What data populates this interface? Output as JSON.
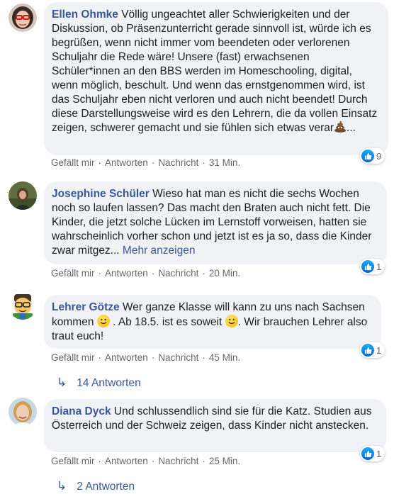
{
  "comments": [
    {
      "author": "Ellen Ohmke",
      "text": "Völlig ungeachtet aller Schwierigkeiten und der Diskussion, ob Präsenzunterricht gerade sinnvoll ist, würde ich es begrüßen, wenn nicht immer vom beendeten oder verlorenen Schuljahr die Rede wäre! Unsere (fast) erwachsenen Schüler*innen an den BBS werden im Homeschooling, digital, wenn möglich, beschult. Und wenn das ernstgenommen wird, ist das Schuljahr eben nicht verloren und auch nicht beendet! Durch diese Darstellungsweise wird es den Lehrern, die da vollen Einsatz zeigen, schwerer gemacht und sie fühlen sich etwas verar",
      "text_end": "...",
      "time": "31 Min.",
      "reactions": "9",
      "avatar_icon": "woman-red-glasses-avatar"
    },
    {
      "author": "Josephine Schüler",
      "text": "Wieso hat man es nicht die sechs Wochen noch so laufen lassen? Das macht den Braten auch nicht fett. Die Kinder, die jetzt solche Lücken im Lernstoff vorweisen, hatten sie wahrscheinlich vorher schon und jetzt ist es ja so, dass die Kinder zwar mitgez...",
      "more": "Mehr anzeigen",
      "time": "20 Min.",
      "reactions": "1",
      "avatar_icon": "woman-outdoor-avatar"
    },
    {
      "author": "Lehrer Götze",
      "text_a": "Wer ganze Klasse will kann zu uns nach Sachsen kommen",
      "text_b": ". Ab 18.5. ist es soweit",
      "text_c": ". Wir brauchen Lehrer also traut euch!",
      "time": "45 Min.",
      "reactions": "1",
      "replies": "14 Antworten",
      "avatar_icon": "teacher-emoji-avatar"
    },
    {
      "author": "Diana Dyck",
      "text": "Und schlussendlich sind sie für die Katz. Studien aus Österreich und der Schweiz zeigen, dass Kinder nicht anstecken.",
      "time": "25 Min.",
      "reactions": "1",
      "replies": "2 Antworten",
      "avatar_icon": "woman-blonde-avatar"
    }
  ],
  "actions": {
    "like": "Gefällt mir",
    "reply": "Antworten",
    "message": "Nachricht",
    "separator": "·"
  },
  "reply_arrow": "↳",
  "colors": {
    "name": "#385898",
    "bubble": "#f0f2f5",
    "meta": "#65676b",
    "like": "#1877f2"
  }
}
